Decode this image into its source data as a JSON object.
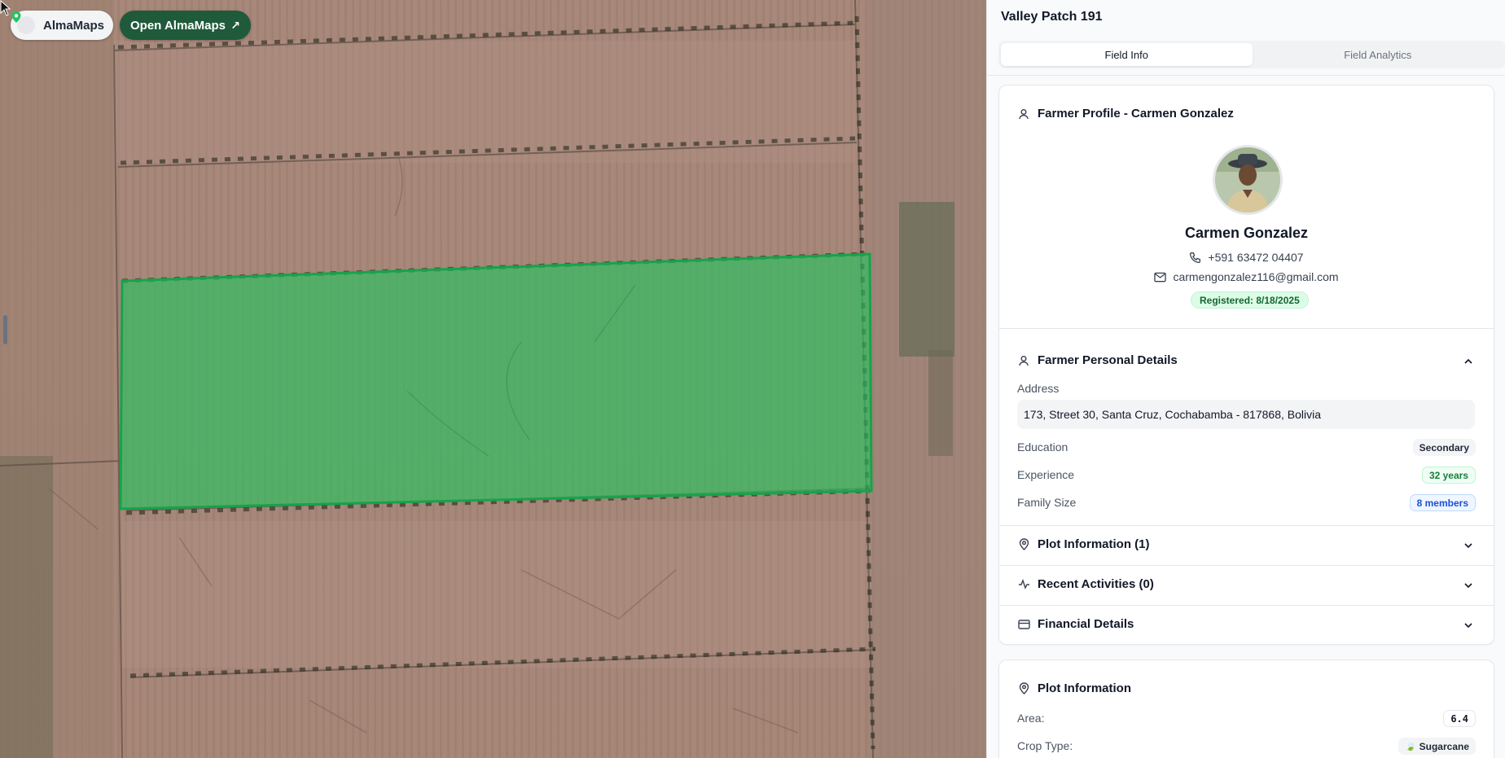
{
  "map": {
    "brand_label": "AlmaMaps",
    "open_label": "Open AlmaMaps",
    "highlight_color": "#22c55e"
  },
  "panel": {
    "title": "Valley Patch 191",
    "tabs": [
      {
        "label": "Field Info",
        "active": true
      },
      {
        "label": "Field Analytics",
        "active": false
      }
    ],
    "farmer_profile": {
      "heading": "Farmer Profile - Carmen Gonzalez",
      "name": "Carmen Gonzalez",
      "phone": "+591 63472 04407",
      "email": "carmengonzalez116@gmail.com",
      "registered": "Registered: 8/18/2025"
    },
    "personal_details": {
      "heading": "Farmer Personal Details",
      "address_label": "Address",
      "address": "173, Street 30, Santa Cruz, Cochabamba - 817868, Bolivia",
      "education_label": "Education",
      "education": "Secondary",
      "experience_label": "Experience",
      "experience": "32 years",
      "family_label": "Family Size",
      "family": "8 members"
    },
    "sections": {
      "plot_info": "Plot Information (1)",
      "recent_activities": "Recent Activities (0)",
      "financial": "Financial Details"
    },
    "plot_card": {
      "heading": "Plot Information",
      "area_label": "Area:",
      "area": "6.4",
      "crop_label": "Crop Type:",
      "crop": "Sugarcane"
    }
  }
}
